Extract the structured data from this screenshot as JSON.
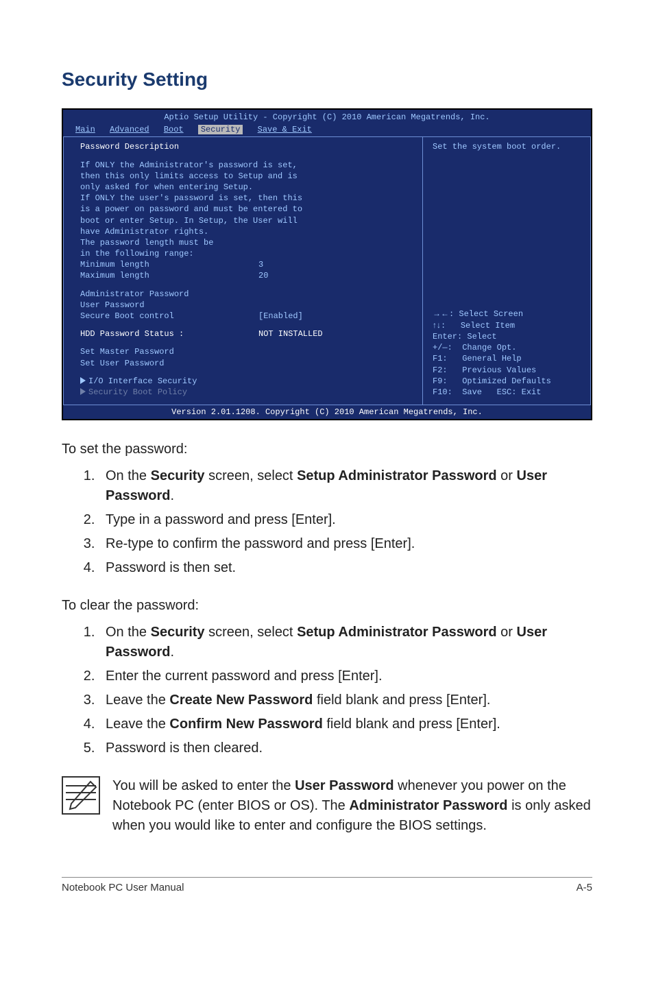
{
  "title": "Security Setting",
  "bios": {
    "header_title": "Aptio Setup Utility - Copyright (C) 2010 American Megatrends, Inc.",
    "tabs": {
      "main": "Main",
      "advanced": "Advanced",
      "boot": "Boot",
      "security": "Security",
      "save": "Save & Exit"
    },
    "left": {
      "pwd_desc_heading": "Password Description",
      "desc_lines": [
        "If ONLY the Administrator's password is set,",
        "then this only limits access to Setup and is",
        "only asked for when entering Setup.",
        "If ONLY the user's password is set, then this",
        "is a power on password and must be entered to",
        "boot or enter Setup. In Setup, the User will",
        "have Administrator rights.",
        "The password length must be",
        "in the following range:"
      ],
      "min_label": "Minimum length",
      "min_val": "3",
      "max_label": "Maximum length",
      "max_val": "20",
      "admin_pw": "Administrator Password",
      "user_pw": "User Password",
      "secure_boot_label": "Secure Boot control",
      "secure_boot_val": "[Enabled]",
      "hdd_label": "HDD Password Status :",
      "hdd_val": "NOT INSTALLED",
      "set_master": "Set Master Password",
      "set_user": "Set User Password",
      "io_if": "I/O Interface Security",
      "sec_boot_policy": "Security Boot Policy"
    },
    "right": {
      "top_help": "Set the system boot order.",
      "keys": {
        "select_screen": "Select Screen",
        "select_item": "Select Item",
        "enter": "Enter: Select",
        "change": "+/—:  Change Opt.",
        "f1": "F1:   General Help",
        "f2": "F2:   Previous Values",
        "f9": "F9:   Optimized Defaults",
        "f10": "F10:  Save   ESC: Exit"
      }
    },
    "footer": "Version 2.01.1208. Copyright (C) 2010 American Megatrends, Inc."
  },
  "set_heading": "To set the password:",
  "set_steps": {
    "s1_pre": "On the ",
    "s1_strong1": "Security",
    "s1_mid": " screen, select ",
    "s1_strong2": "Setup Administrator Password",
    "s1_or": " or ",
    "s1_strong3": "User Password",
    "s1_end": ".",
    "s2": "Type in a password and press [Enter].",
    "s3": "Re-type to confirm the password and press [Enter].",
    "s4": "Password is then set."
  },
  "clear_heading": "To clear the password:",
  "clear_steps": {
    "c1_pre": "On the ",
    "c1_strong1": "Security",
    "c1_mid": " screen, select ",
    "c1_strong2": "Setup Administrator Password",
    "c1_or": " or ",
    "c1_strong3": "User Password",
    "c1_end": ".",
    "c2": "Enter the current password and press [Enter].",
    "c3_pre": "Leave the ",
    "c3_strong": "Create New Password",
    "c3_post": " field blank and press [Enter].",
    "c4_pre": "Leave the ",
    "c4_strong": "Confirm New Password",
    "c4_post": " field blank and press [Enter].",
    "c5": "Password is then cleared."
  },
  "note": {
    "p1_pre": "You will be asked to enter the ",
    "p1_strong1": "User Password",
    "p1_mid": " whenever you power on the Notebook PC (enter BIOS or OS). The ",
    "p1_strong2": "Administrator Password",
    "p1_post": " is only asked when you would like to enter and configure the BIOS settings."
  },
  "footer": {
    "left": "Notebook PC User Manual",
    "right": "A-5"
  }
}
